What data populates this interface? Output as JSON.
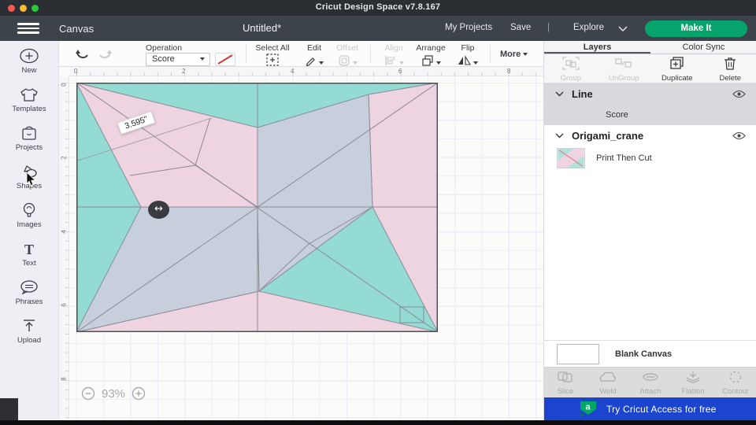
{
  "titlebar": {
    "title": "Cricut Design Space  v7.8.167"
  },
  "header": {
    "canvas_label": "Canvas",
    "document_title": "Untitled*",
    "my_projects": "My Projects",
    "save": "Save",
    "separator": "|",
    "explore": "Explore",
    "make_it": "Make It"
  },
  "toolbar": {
    "operation_label": "Operation",
    "operation_value": "Score",
    "select_all": "Select All",
    "edit": "Edit",
    "offset": "Offset",
    "align": "Align",
    "arrange": "Arrange",
    "flip": "Flip",
    "more": "More"
  },
  "sidebar": {
    "items": [
      {
        "label": "New"
      },
      {
        "label": "Templates"
      },
      {
        "label": "Projects"
      },
      {
        "label": "Shapes"
      },
      {
        "label": "Images"
      },
      {
        "label": "Text"
      },
      {
        "label": "Phrases"
      },
      {
        "label": "Upload"
      }
    ]
  },
  "canvas": {
    "ruler_h": [
      "0",
      "2",
      "4",
      "6",
      "8"
    ],
    "ruler_v": [
      "0",
      "2",
      "4",
      "6",
      "8"
    ],
    "measurement_label": "3.595\"",
    "zoom_level": "93%"
  },
  "layers_panel": {
    "tabs": [
      {
        "label": "Layers"
      },
      {
        "label": "Color Sync"
      }
    ],
    "actions": [
      {
        "label": "Group"
      },
      {
        "label": "UnGroup"
      },
      {
        "label": "Duplicate"
      },
      {
        "label": "Delete"
      }
    ],
    "groups": [
      {
        "name": "Line",
        "child": "Score"
      },
      {
        "name": "Origami_crane",
        "child": "Print Then Cut"
      }
    ],
    "blank_canvas_label": "Blank Canvas",
    "tools": [
      {
        "label": "Slice"
      },
      {
        "label": "Weld"
      },
      {
        "label": "Attach"
      },
      {
        "label": "Flatten"
      },
      {
        "label": "Contour"
      }
    ],
    "banner_text": "Try Cricut Access for free",
    "banner_logo_letter": "a"
  },
  "colors": {
    "make_it_green": "#06a36c",
    "banner_blue": "#1b45cf",
    "logo_green": "#00a866",
    "pattern_teal": "#93dbd3",
    "pattern_pink": "#eed3e0",
    "pattern_bluegray": "#c6cfdb",
    "score_line_red": "#d23b2e"
  }
}
